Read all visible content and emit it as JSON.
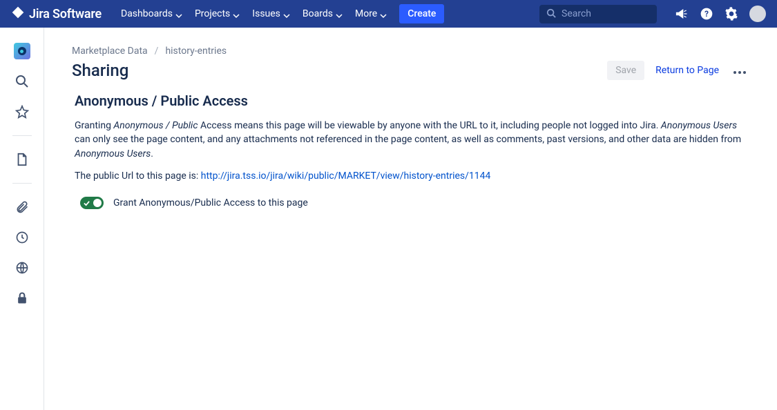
{
  "brand": {
    "name": "Jira Software"
  },
  "nav": {
    "items": [
      {
        "label": "Dashboards"
      },
      {
        "label": "Projects"
      },
      {
        "label": "Issues"
      },
      {
        "label": "Boards"
      },
      {
        "label": "More"
      }
    ],
    "create_label": "Create"
  },
  "search": {
    "placeholder": "Search"
  },
  "breadcrumbs": {
    "project": "Marketplace Data",
    "separator": "/",
    "page": "history-entries"
  },
  "title": "Sharing",
  "actions": {
    "save_label": "Save",
    "return_label": "Return to Page"
  },
  "section": {
    "heading": "Anonymous / Public Access",
    "para1_pre": "Granting ",
    "para1_em1": "Anonymous / Public",
    "para1_mid1": " Access means this page will be viewable by anyone with the URL to it, including people not logged into Jira. ",
    "para1_em2": "Anonymous Users",
    "para1_mid2": " can only see the page content, and any attachments not referenced in the page content, as well as comments, past versions, and other data are hidden from ",
    "para1_em3": "Anonymous Users",
    "para1_end": ".",
    "url_line_pre": "The public Url to this page is: ",
    "url": "http://jira.tss.io/jira/wiki/public/MARKET/view/history-entries/1144",
    "toggle_label": "Grant Anonymous/Public Access to this page"
  }
}
